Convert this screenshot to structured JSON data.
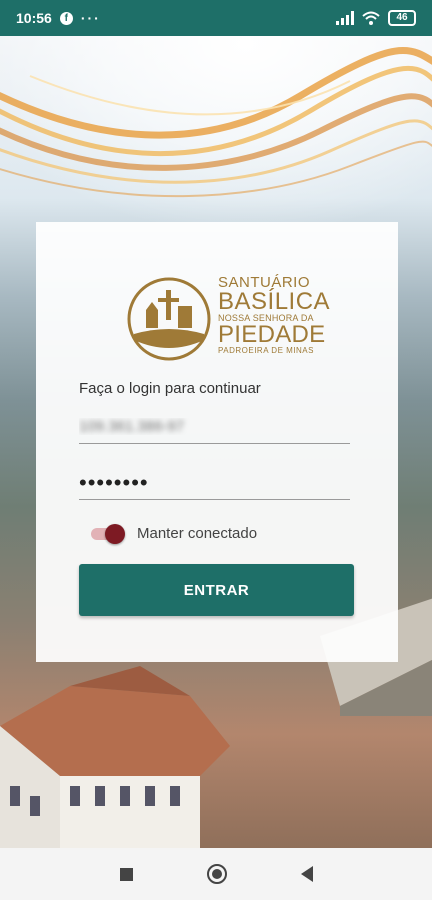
{
  "status_bar": {
    "time": "10:56",
    "notification_dots": "···",
    "battery_level": "46"
  },
  "logo": {
    "line1": "SANTUÁRIO",
    "line2": "BASÍLICA",
    "line3": "NOSSA SENHORA DA",
    "line4": "PIEDADE",
    "line5": "PADROEIRA DE MINAS"
  },
  "login": {
    "subtitle": "Faça o login para continuar",
    "username_value": "109.361.386-97",
    "password_value": "••••••••",
    "keep_connected_label": "Manter conectado",
    "keep_connected": true,
    "submit_label": "ENTRAR"
  },
  "colors": {
    "primary": "#1e6f68",
    "toggle_accent": "#7d1a23",
    "logo_gold": "#9f7a37"
  }
}
